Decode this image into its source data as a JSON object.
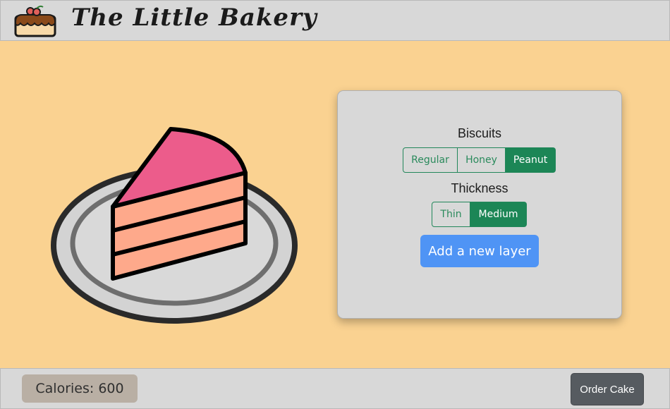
{
  "header": {
    "brand": "The Little Bakery",
    "logo_icon": "cake-icon"
  },
  "illustration": {
    "icon": "cake-slice-on-plate-icon"
  },
  "panel": {
    "biscuits": {
      "label": "Biscuits",
      "options": [
        "Regular",
        "Honey",
        "Peanut"
      ],
      "selected": "Peanut"
    },
    "thickness": {
      "label": "Thickness",
      "options": [
        "Thin",
        "Medium"
      ],
      "selected": "Medium"
    },
    "add_layer_label": "Add a new layer"
  },
  "footer": {
    "calories": "Calories: 600",
    "order_label": "Order Cake"
  },
  "colors": {
    "background": "#fad291",
    "bar": "#d8d8d8",
    "accent_green": "#1c8656",
    "add_button": "#4f94f5",
    "order_button": "#565b60",
    "frosting": "#ec5c8b",
    "sponge": "#fea98b"
  }
}
